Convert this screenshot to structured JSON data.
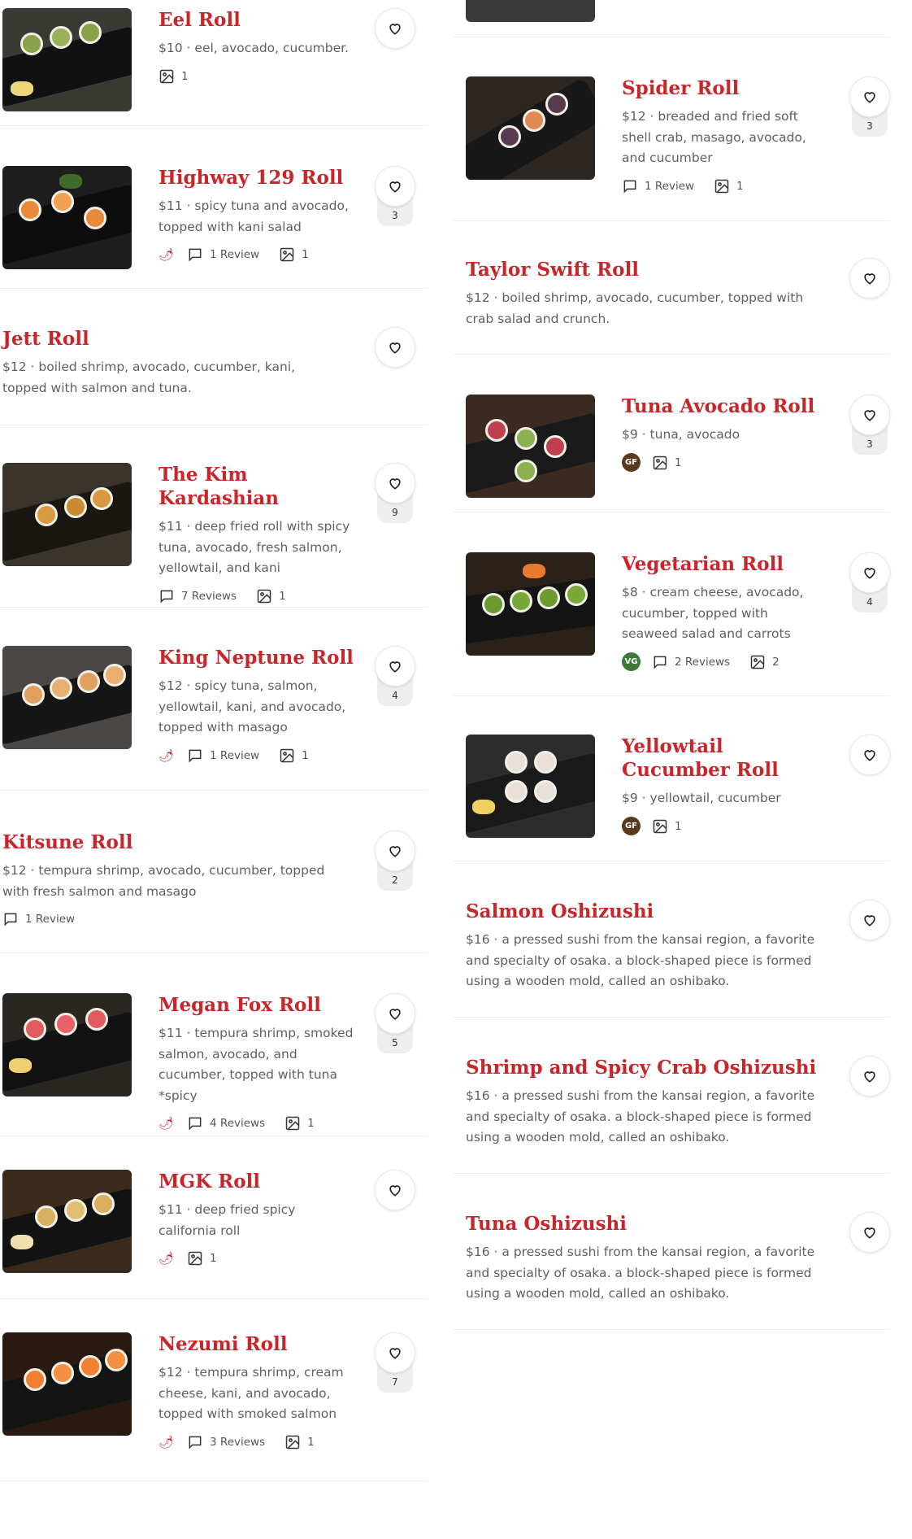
{
  "left_items": [
    {
      "name": "Eel Roll",
      "price": "$10",
      "sep": "·",
      "desc": "eel, avocado, cucumber.",
      "photos": "1"
    },
    {
      "name": "Highway 129 Roll",
      "price": "$11",
      "sep": "·",
      "desc": "spicy tuna and avocado, topped with kani salad",
      "reviews": "1 Review",
      "photos": "1",
      "likes": "3"
    },
    {
      "name": "Jett Roll",
      "price": "$12",
      "sep": "·",
      "desc": "boiled shrimp, avocado, cucumber, kani, topped with salmon and tuna."
    },
    {
      "name": "The Kim Kardashian",
      "price": "$11",
      "sep": "·",
      "desc": "deep fried roll with spicy tuna, avocado, fresh salmon, yellowtail, and kani",
      "reviews": "7 Reviews",
      "photos": "1",
      "likes": "9"
    },
    {
      "name": "King Neptune Roll",
      "price": "$12",
      "sep": "·",
      "desc": "spicy tuna, salmon, yellowtail, kani, and avocado, topped with masago",
      "reviews": "1 Review",
      "photos": "1",
      "likes": "4"
    },
    {
      "name": "Kitsune Roll",
      "price": "$12",
      "sep": "·",
      "desc": "tempura shrimp, avocado, cucumber, topped with fresh salmon and masago",
      "reviews": "1 Review",
      "likes": "2"
    },
    {
      "name": "Megan Fox Roll",
      "price": "$11",
      "sep": "·",
      "desc": "tempura shrimp, smoked salmon, avocado, and cucumber, topped with tuna *spicy",
      "reviews": "4 Reviews",
      "photos": "1",
      "likes": "5"
    },
    {
      "name": "MGK Roll",
      "price": "$11",
      "sep": "·",
      "desc": "deep fried spicy california roll",
      "photos": "1"
    },
    {
      "name": "Nezumi Roll",
      "price": "$12",
      "sep": "·",
      "desc": "tempura shrimp, cream cheese, kani, and avocado, topped with smoked salmon",
      "reviews": "3 Reviews",
      "photos": "1",
      "likes": "7"
    }
  ],
  "right_items": [
    {
      "name": "Spider Roll",
      "price": "$12",
      "sep": "·",
      "desc": "breaded and fried soft shell crab, masago, avocado, and cucumber",
      "reviews": "1 Review",
      "photos": "1",
      "likes": "3"
    },
    {
      "name": "Taylor Swift Roll",
      "price": "$12",
      "sep": "·",
      "desc": "boiled shrimp, avocado, cucumber, topped with crab salad and crunch."
    },
    {
      "name": "Tuna Avocado Roll",
      "price": "$9",
      "sep": "·",
      "desc": "tuna, avocado",
      "badge": "GF",
      "photos": "1",
      "likes": "3"
    },
    {
      "name": "Vegetarian Roll",
      "price": "$8",
      "sep": "·",
      "desc": "cream cheese, avocado, cucumber, topped with seaweed salad and carrots",
      "badge": "VG",
      "reviews": "2 Reviews",
      "photos": "2",
      "likes": "4"
    },
    {
      "name": "Yellowtail Cucumber Roll",
      "price": "$9",
      "sep": "·",
      "desc": "yellowtail, cucumber",
      "badge": "GF",
      "photos": "1"
    },
    {
      "name": "Salmon Oshizushi",
      "price": "$16",
      "sep": "·",
      "desc": "a pressed sushi from the kansai region, a favorite and specialty of osaka. a block-shaped piece is formed using a wooden mold, called an oshibako."
    },
    {
      "name": "Shrimp and Spicy Crab Oshizushi",
      "price": "$16",
      "sep": "·",
      "desc": "a pressed sushi from the kansai region, a favorite and specialty of osaka. a block-shaped piece is formed using a wooden mold, called an oshibako."
    },
    {
      "name": "Tuna Oshizushi",
      "price": "$16",
      "sep": "·",
      "desc": "a pressed sushi from the kansai region, a favorite and specialty of osaka. a block-shaped piece is formed using a wooden mold, called an oshibako."
    }
  ],
  "colors": {
    "accent": "#c8262b",
    "gf_badge": "#5a3a1c",
    "vg_badge": "#3c7a3a",
    "spicy": "#c8262b"
  },
  "icons": {
    "favorite": "heart-icon",
    "reviews": "comment-icon",
    "photos": "image-icon",
    "spicy": "chili-icon"
  }
}
